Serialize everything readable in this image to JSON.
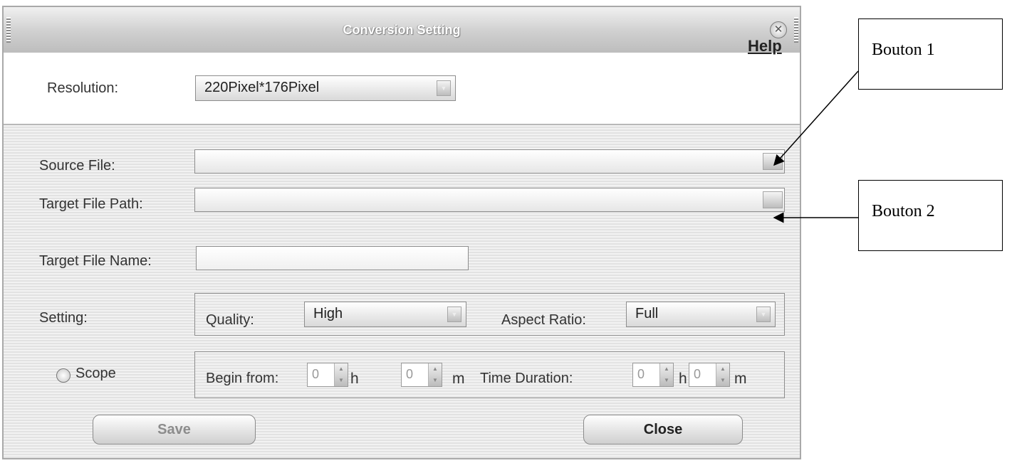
{
  "window": {
    "title": "Conversion Setting",
    "close_glyph": "✕",
    "close_icon": "close-icon"
  },
  "resolution": {
    "label": "Resolution:",
    "value": "220Pixel*176Pixel"
  },
  "help_link": "Help",
  "source_file": {
    "label": "Source File:",
    "value": ""
  },
  "target_path": {
    "label": "Target File Path:",
    "value": ""
  },
  "target_name": {
    "label": "Target File Name:",
    "value": ""
  },
  "setting": {
    "label": "Setting:",
    "quality_label": "Quality:",
    "quality_value": "High",
    "aspect_label": "Aspect Ratio:",
    "aspect_value": "Full"
  },
  "scope": {
    "label": "Scope",
    "checked": false,
    "begin_label": "Begin from:",
    "begin_h": "0",
    "begin_m": "0",
    "duration_label": "Time Duration:",
    "duration_h": "0",
    "duration_m": "0",
    "h_unit": "h",
    "m_unit": "m"
  },
  "buttons": {
    "save": "Save",
    "close": "Close"
  },
  "annotations": {
    "button1": "Bouton 1",
    "button2": "Bouton 2"
  },
  "colors": {
    "titlebar": "#c8c8c8",
    "panel": "#ececec",
    "title_text": "#ffffff"
  }
}
